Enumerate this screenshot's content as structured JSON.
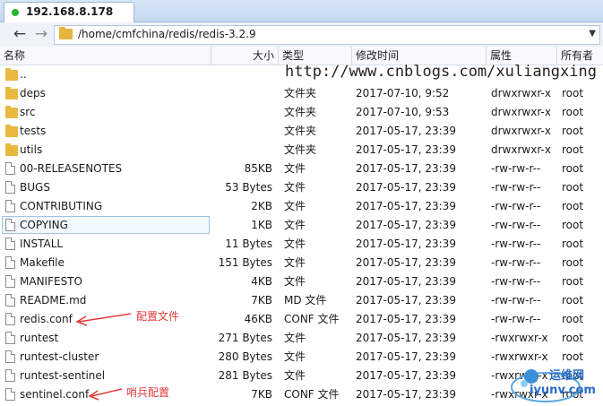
{
  "tab": {
    "title": "192.168.8.178",
    "status_color": "#2fb52f"
  },
  "path": {
    "value": "/home/cmfchina/redis/redis-3.2.9"
  },
  "columns": {
    "name": "名称",
    "size": "大小",
    "type": "类型",
    "modified": "修改时间",
    "attrs": "属性",
    "owner": "所有者"
  },
  "files": [
    {
      "name": "..",
      "kind": "folder",
      "size": "",
      "type": "",
      "modified": "",
      "attrs": "",
      "owner": ""
    },
    {
      "name": "deps",
      "kind": "folder",
      "size": "",
      "type": "文件夹",
      "modified": "2017-07-10, 9:52",
      "attrs": "drwxrwxr-x",
      "owner": "root"
    },
    {
      "name": "src",
      "kind": "folder",
      "size": "",
      "type": "文件夹",
      "modified": "2017-07-10, 9:53",
      "attrs": "drwxrwxr-x",
      "owner": "root"
    },
    {
      "name": "tests",
      "kind": "folder",
      "size": "",
      "type": "文件夹",
      "modified": "2017-05-17, 23:39",
      "attrs": "drwxrwxr-x",
      "owner": "root"
    },
    {
      "name": "utils",
      "kind": "folder",
      "size": "",
      "type": "文件夹",
      "modified": "2017-05-17, 23:39",
      "attrs": "drwxrwxr-x",
      "owner": "root"
    },
    {
      "name": "00-RELEASENOTES",
      "kind": "file",
      "size": "85KB",
      "type": "文件",
      "modified": "2017-05-17, 23:39",
      "attrs": "-rw-rw-r--",
      "owner": "root"
    },
    {
      "name": "BUGS",
      "kind": "file",
      "size": "53 Bytes",
      "type": "文件",
      "modified": "2017-05-17, 23:39",
      "attrs": "-rw-rw-r--",
      "owner": "root"
    },
    {
      "name": "CONTRIBUTING",
      "kind": "file",
      "size": "2KB",
      "type": "文件",
      "modified": "2017-05-17, 23:39",
      "attrs": "-rw-rw-r--",
      "owner": "root"
    },
    {
      "name": "COPYING",
      "kind": "file",
      "size": "1KB",
      "type": "文件",
      "modified": "2017-05-17, 23:39",
      "attrs": "-rw-rw-r--",
      "owner": "root"
    },
    {
      "name": "INSTALL",
      "kind": "file",
      "size": "11 Bytes",
      "type": "文件",
      "modified": "2017-05-17, 23:39",
      "attrs": "-rw-rw-r--",
      "owner": "root"
    },
    {
      "name": "Makefile",
      "kind": "file",
      "size": "151 Bytes",
      "type": "文件",
      "modified": "2017-05-17, 23:39",
      "attrs": "-rw-rw-r--",
      "owner": "root"
    },
    {
      "name": "MANIFESTO",
      "kind": "file",
      "size": "4KB",
      "type": "文件",
      "modified": "2017-05-17, 23:39",
      "attrs": "-rw-rw-r--",
      "owner": "root"
    },
    {
      "name": "README.md",
      "kind": "file",
      "size": "7KB",
      "type": "MD 文件",
      "modified": "2017-05-17, 23:39",
      "attrs": "-rw-rw-r--",
      "owner": "root"
    },
    {
      "name": "redis.conf",
      "kind": "file",
      "size": "46KB",
      "type": "CONF 文件",
      "modified": "2017-05-17, 23:39",
      "attrs": "-rw-rw-r--",
      "owner": "root"
    },
    {
      "name": "runtest",
      "kind": "file",
      "size": "271 Bytes",
      "type": "文件",
      "modified": "2017-05-17, 23:39",
      "attrs": "-rwxrwxr-x",
      "owner": "root"
    },
    {
      "name": "runtest-cluster",
      "kind": "file",
      "size": "280 Bytes",
      "type": "文件",
      "modified": "2017-05-17, 23:39",
      "attrs": "-rwxrwxr-x",
      "owner": "root"
    },
    {
      "name": "runtest-sentinel",
      "kind": "file",
      "size": "281 Bytes",
      "type": "文件",
      "modified": "2017-05-17, 23:39",
      "attrs": "-rwxrwxr-x",
      "owner": "root"
    },
    {
      "name": "sentinel.conf",
      "kind": "file",
      "size": "7KB",
      "type": "CONF 文件",
      "modified": "2017-05-17, 23:39",
      "attrs": "-rwxrwxr-x",
      "owner": "root"
    }
  ],
  "annotations": {
    "watermark": "http://www.cnblogs.com/xuliangxing",
    "note_redis": "配置文件",
    "note_sentinel": "哨兵配置",
    "arrow_color": "#e23a3a"
  },
  "logo": {
    "line1": "运维网",
    "line2": "iyunv.com"
  }
}
